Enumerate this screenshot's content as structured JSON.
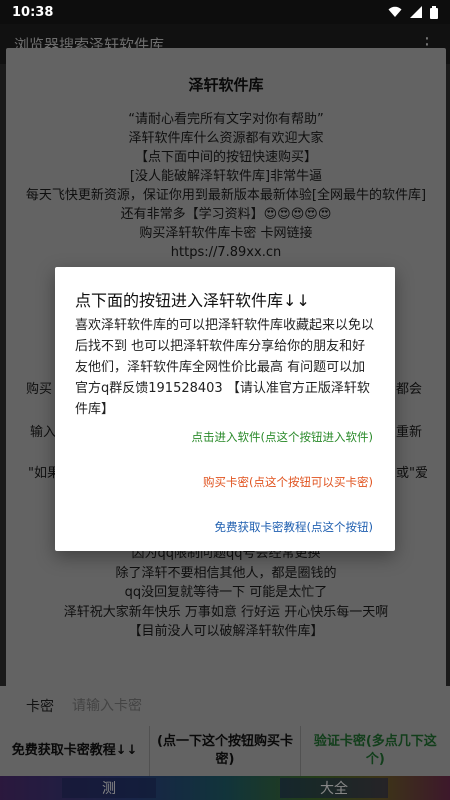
{
  "status_bar": {
    "time": "10:38"
  },
  "app_bar": {
    "title": "浏览器搜索泽轩软件库",
    "more": "⋮"
  },
  "back_dialog": {
    "title": "泽轩软件库",
    "lines": [
      "“请耐心看完所有文字对你有帮助”",
      "泽轩软件库什么资源都有欢迎大家",
      "【点下面中间的按钮快速购买】",
      "[没人能破解泽轩软件库]非常牛逼",
      "每天飞快更新资源，保证你用到最新版本最新体验[全网最牛的软件库]还有非常多【学习资料】😍😍😍😍😍",
      "购买泽轩软件库卡密 卡网链接",
      "https://7.89xx.cn"
    ],
    "frag_left_1": "购买",
    "frag_right_1": "都会",
    "frag_left_2": "输入",
    "frag_right_2": "重新",
    "frag_left_3": "\"如果",
    "frag_right_3": "或\"爱",
    "lines_bottom": [
      "因为qq限制问题qq号会经常更换",
      "除了泽轩不要相信其他人，都是圈钱的",
      "qq没回复就等待一下 可能是太忙了",
      "泽轩祝大家新年快乐 万事如意 行好运 开心快乐每一天啊",
      "【目前没人可以破解泽轩软件库】"
    ]
  },
  "kami": {
    "label": "卡密",
    "placeholder": "请输入卡密"
  },
  "buttons": {
    "free_tutorial": "免费获取卡密教程↓↓",
    "buy": "(点一下这个按钮购买卡密)",
    "verify": "验证卡密(多点几下这个)"
  },
  "bottom_nav": {
    "left": "测",
    "right": "大全"
  },
  "front_dialog": {
    "title": "点下面的按钮进入泽轩软件库↓↓",
    "message": "喜欢泽轩软件库的可以把泽轩软件库收藏起来以免以后找不到 也可以把泽轩软件库分享给你的朋友和好友他们，泽轩软件库全网性价比最高 有问题可以加官方q群反馈191528403 【请认准官方正版泽轩软件库】",
    "action_enter": "点击进入软件(点这个按钮进入软件)",
    "action_buy": "购买卡密(点这个按钮可以买卡密)",
    "action_free": "免费获取卡密教程(点这个按钮)"
  }
}
